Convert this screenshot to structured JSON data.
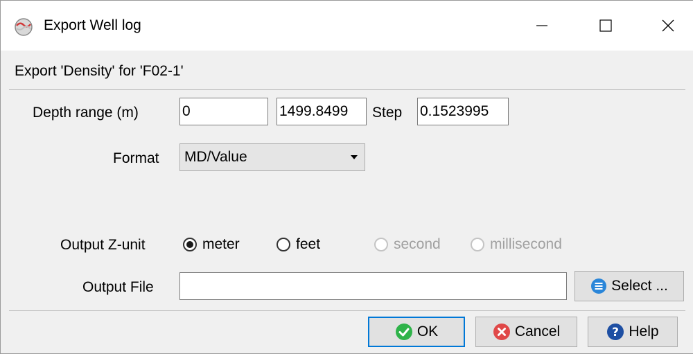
{
  "window": {
    "title": "Export Well log",
    "app_icon": "opendtect-icon",
    "controls": [
      "minimize-icon",
      "maximize-icon",
      "close-icon"
    ]
  },
  "header": {
    "subtitle": "Export 'Density' for 'F02-1'"
  },
  "depth": {
    "label": "Depth range (m)",
    "start": "0",
    "stop": "1499.8499",
    "step_label": "Step",
    "step": "0.1523995"
  },
  "format": {
    "label": "Format",
    "selected": "MD/Value"
  },
  "zunit": {
    "label": "Output Z-unit",
    "options": [
      {
        "label": "meter",
        "checked": true,
        "enabled": true
      },
      {
        "label": "feet",
        "checked": false,
        "enabled": true
      },
      {
        "label": "second",
        "checked": false,
        "enabled": false
      },
      {
        "label": "millisecond",
        "checked": false,
        "enabled": false
      }
    ]
  },
  "output_file": {
    "label": "Output File",
    "value": "",
    "select_label": "Select ...",
    "select_icon": "list-icon"
  },
  "buttons": {
    "ok_label": "OK",
    "cancel_label": "Cancel",
    "help_label": "Help"
  },
  "colors": {
    "ok_green": "#2fb34a",
    "cancel_red": "#e04848",
    "help_blue": "#1e4fa3",
    "select_blue": "#2a86d9",
    "default_border": "#0078d7"
  }
}
